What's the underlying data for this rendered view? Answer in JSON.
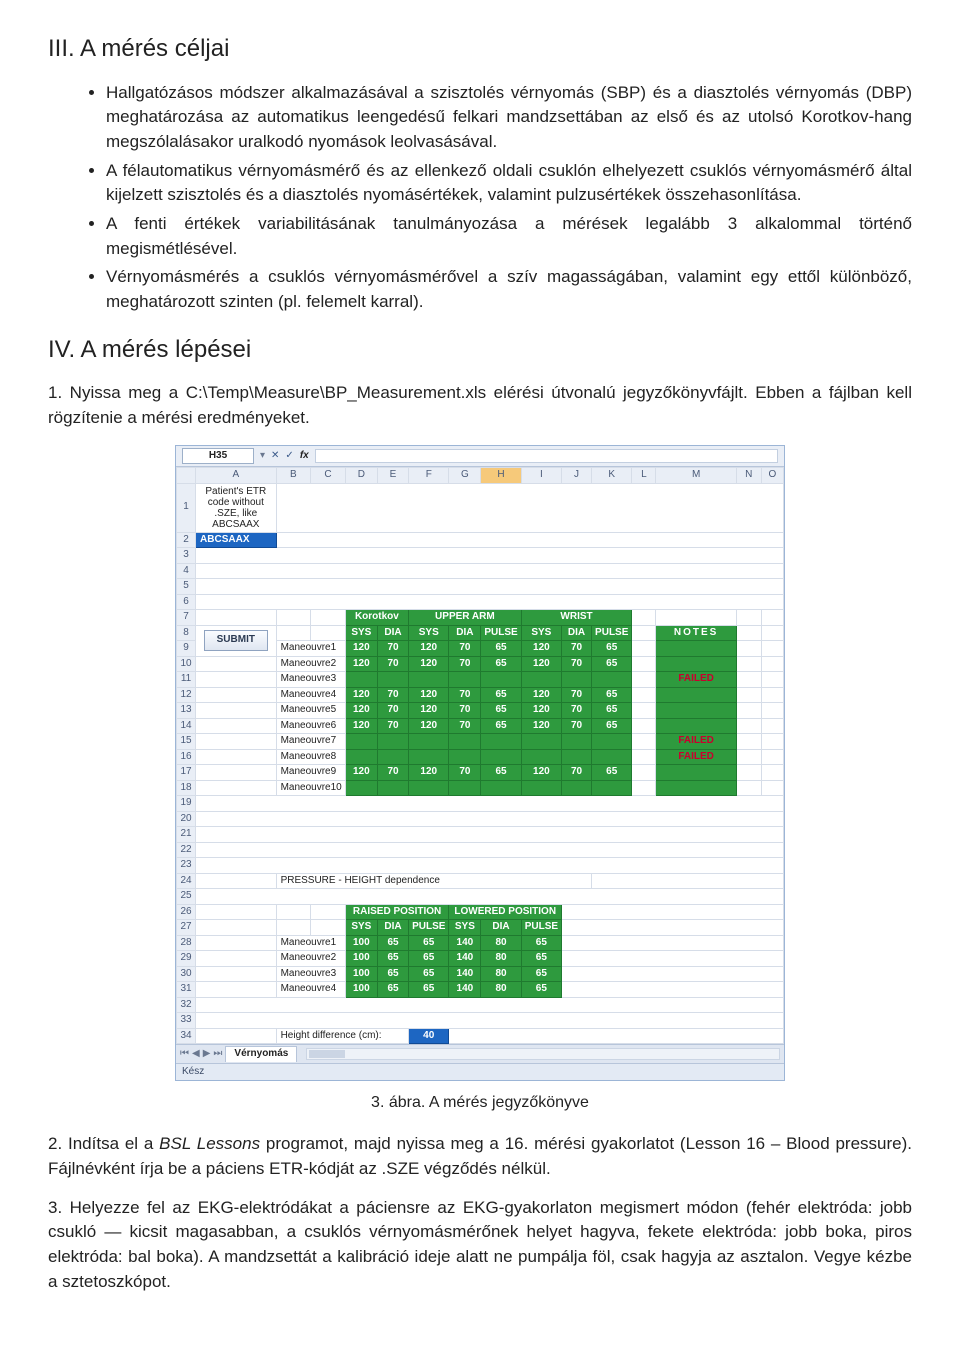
{
  "section3": {
    "title": "III. A mérés céljai",
    "bullets": [
      "Hallgatózásos módszer alkalmazásával a szisztolés vérnyomás (SBP) és a diasztolés vérnyomás (DBP) meghatározása az automatikus leengedésű felkari mandzsettában az első és az utolsó Korotkov-hang megszólalásakor uralkodó nyomások leolvasásával.",
      "A félautomatikus vérnyomásmérő és az ellenkező oldali csuklón elhelyezett csuklós vérnyomásmérő által kijelzett szisztolés és a diasztolés nyomásértékek, valamint pulzusértékek összehasonlítása.",
      "A fenti értékek variabilitásának tanulmányozása a mérések legalább 3 alkalommal történő megismétlésével.",
      "Vérnyomásmérés a csuklós vérnyomásmérővel a szív magasságában, valamint egy ettől különböző, meghatározott szinten (pl. felemelt karral)."
    ]
  },
  "section4": {
    "title": "IV. A mérés lépései",
    "step1a": "1. Nyissa meg a C:\\Temp\\Measure\\BP_Measurement.xls elérési útvonalú jegyzőkönyvfájlt. Ebben a fájlban kell rögzítenie a mérési eredményeket.",
    "caption": "3. ábra. A mérés jegyzőkönyve",
    "step2_pre": "2. Indítsa el a ",
    "step2_it": "BSL Lessons",
    "step2_post": " programot, majd nyissa meg a 16. mérési gyakorlatot (Lesson 16 – Blood pressure). Fájlnévként írja be a páciens ETR-kódját az .SZE végződés nélkül.",
    "step3": "3. Helyezze fel az EKG-elektródákat a páciensre az EKG-gyakorlaton megismert módon (fehér elektróda: jobb csukló — kicsit magasabban, a csuklós vérnyomásmérőnek helyet hagyva, fekete elektróda: jobb boka, piros elektróda: bal boka). A mandzsettát a kalibráció ideje alatt ne pumpálja föl, csak hagyja az asztalon. Vegye kézbe a sztetoszkópot."
  },
  "ss": {
    "cellref": "H35",
    "fx": "fx",
    "cols": [
      "A",
      "B",
      "C",
      "D",
      "E",
      "F",
      "G",
      "H",
      "I",
      "J",
      "K",
      "L",
      "M",
      "N",
      "O"
    ],
    "rows1": [
      "1",
      "2",
      "3",
      "4",
      "5",
      "6",
      "7",
      "8",
      "9",
      "10",
      "11",
      "12",
      "13",
      "14",
      "15",
      "16",
      "17",
      "18",
      "19"
    ],
    "rows2": [
      "20",
      "21",
      "22",
      "23",
      "24",
      "25",
      "26",
      "27",
      "28",
      "29",
      "30",
      "31",
      "32",
      "33",
      "34"
    ],
    "a1": "Patient's ETR code\nwithout .SZE, like\nABCSAAX",
    "a2": "ABCSAAX",
    "submit": "SUBMIT",
    "hdr": {
      "kor": "Korotkov",
      "upper": "UPPER ARM",
      "wrist": "WRIST",
      "sys": "SYS",
      "dia": "DIA",
      "pulse": "PULSE",
      "notes": "NOTES"
    },
    "manLabels": [
      "Maneouvre1",
      "Maneouvre2",
      "Maneouvre3",
      "Maneouvre4",
      "Maneouvre5",
      "Maneouvre6",
      "Maneouvre7",
      "Maneouvre8",
      "Maneouvre9",
      "Maneouvre10"
    ],
    "failed": "FAILED",
    "rows_data": {
      "r9": {
        "d": "120",
        "e": "70",
        "f": "120",
        "g": "70",
        "h": "65",
        "i": "120",
        "j": "70",
        "k": "65"
      },
      "r10": {
        "d": "120",
        "e": "70",
        "f": "120",
        "g": "70",
        "h": "65",
        "i": "120",
        "j": "70",
        "k": "65"
      },
      "r12": {
        "d": "120",
        "e": "70",
        "f": "120",
        "g": "70",
        "h": "65",
        "i": "120",
        "j": "70",
        "k": "65"
      },
      "r13": {
        "d": "120",
        "e": "70",
        "f": "120",
        "g": "70",
        "h": "65",
        "i": "120",
        "j": "70",
        "k": "65"
      },
      "r14": {
        "d": "120",
        "e": "70",
        "f": "120",
        "g": "70",
        "h": "65",
        "i": "120",
        "j": "70",
        "k": "65"
      },
      "r17": {
        "d": "120",
        "e": "70",
        "f": "120",
        "g": "70",
        "h": "65",
        "i": "120",
        "j": "70",
        "k": "65"
      }
    },
    "press_title": "PRESSURE - HEIGHT dependence",
    "hdr2": {
      "raised": "RAISED POSITION",
      "lowered": "LOWERED POSITION",
      "sys": "SYS",
      "dia": "DIA",
      "pulse": "PULSE"
    },
    "man2Labels": [
      "Maneouvre1",
      "Maneouvre2",
      "Maneouvre3",
      "Maneouvre4"
    ],
    "rows2_data": {
      "r28": {
        "d": "100",
        "e": "65",
        "f": "65",
        "g": "140",
        "h": "80",
        "i": "65"
      },
      "r29": {
        "d": "100",
        "e": "65",
        "f": "65",
        "g": "140",
        "h": "80",
        "i": "65"
      },
      "r30": {
        "d": "100",
        "e": "65",
        "f": "65",
        "g": "140",
        "h": "80",
        "i": "65"
      },
      "r31": {
        "d": "100",
        "e": "65",
        "f": "65",
        "g": "140",
        "h": "80",
        "i": "65"
      }
    },
    "height_label": "Height difference (cm):",
    "height_val": "40",
    "tab": "Vérnyomás",
    "status": "Kész"
  }
}
